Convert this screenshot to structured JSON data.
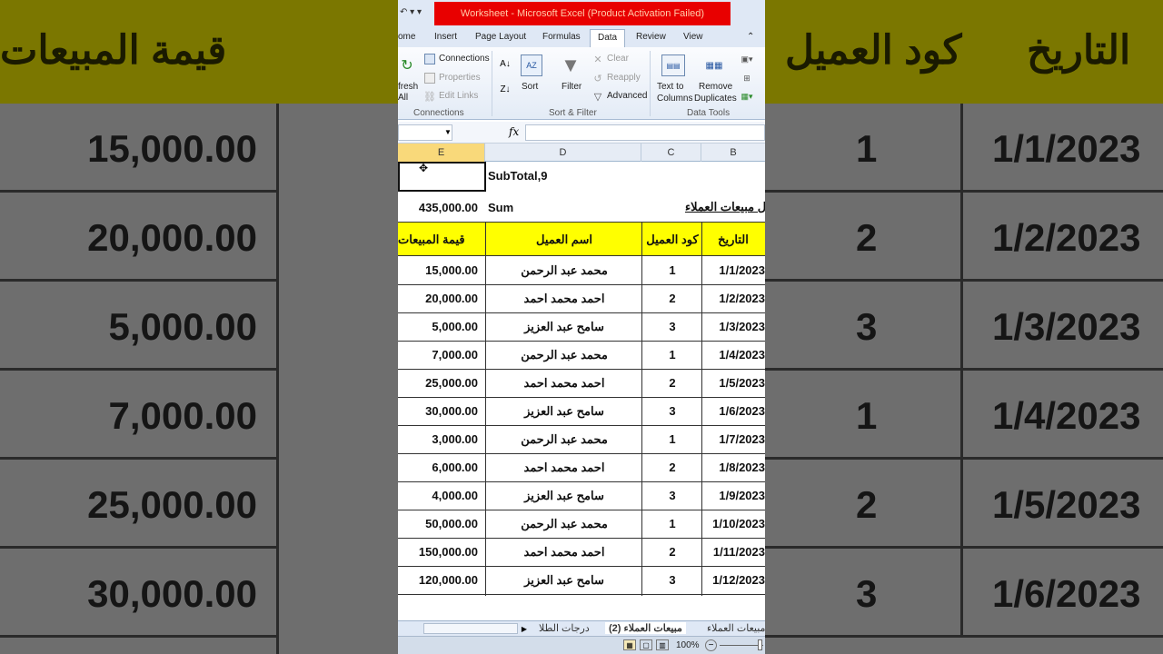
{
  "background": {
    "headers": [
      "قيمة المبيعات",
      "كود العميل",
      "التاريخ"
    ],
    "left_values": [
      "15,000.00",
      "20,000.00",
      "5,000.00",
      "7,000.00",
      "25,000.00",
      "30,000.00"
    ],
    "right_codes": [
      "1",
      "2",
      "3",
      "1",
      "2",
      "3"
    ],
    "right_dates": [
      "1/1/2023",
      "1/2/2023",
      "1/3/2023",
      "1/4/2023",
      "1/5/2023",
      "1/6/2023"
    ]
  },
  "window": {
    "title": "Worksheet - Microsoft Excel (Product Activation Failed)"
  },
  "ribbon": {
    "tabs": [
      "ome",
      "Insert",
      "Page Layout",
      "Formulas",
      "Data",
      "Review",
      "View"
    ],
    "active_tab": "Data",
    "connections": {
      "refresh": "fresh",
      "refresh2": "All",
      "connections": "Connections",
      "properties": "Properties",
      "edit_links": "Edit Links",
      "label": "Connections"
    },
    "sort_filter": {
      "sort": "Sort",
      "filter": "Filter",
      "clear": "Clear",
      "reapply": "Reapply",
      "advanced": "Advanced",
      "label": "Sort & Filter"
    },
    "data_tools": {
      "text_to": "Text to",
      "columns": "Columns",
      "remove": "Remove",
      "duplicates": "Duplicates",
      "label": "Data Tools"
    }
  },
  "formula_bar": {
    "fx": "fx",
    "content": ""
  },
  "columns": [
    "E",
    "D",
    "C",
    "B"
  ],
  "sheet": {
    "subtotal_label": "SubTotal,9",
    "sum_value": "435,000.00",
    "sum_label": "Sum",
    "title_partial": "ل مبيعات العملاء",
    "headers": {
      "value": "قيمة المبيعات",
      "name": "اسم العميل",
      "code": "كود العميل",
      "date": "التاريخ"
    },
    "rows": [
      {
        "value": "15,000.00",
        "name": "محمد عبد الرحمن",
        "code": "1",
        "date": "1/1/2023"
      },
      {
        "value": "20,000.00",
        "name": "احمد محمد احمد",
        "code": "2",
        "date": "1/2/2023"
      },
      {
        "value": "5,000.00",
        "name": "سامح عبد العزيز",
        "code": "3",
        "date": "1/3/2023"
      },
      {
        "value": "7,000.00",
        "name": "محمد عبد الرحمن",
        "code": "1",
        "date": "1/4/2023"
      },
      {
        "value": "25,000.00",
        "name": "احمد محمد احمد",
        "code": "2",
        "date": "1/5/2023"
      },
      {
        "value": "30,000.00",
        "name": "سامح عبد العزيز",
        "code": "3",
        "date": "1/6/2023"
      },
      {
        "value": "3,000.00",
        "name": "محمد عبد الرحمن",
        "code": "1",
        "date": "1/7/2023"
      },
      {
        "value": "6,000.00",
        "name": "احمد محمد احمد",
        "code": "2",
        "date": "1/8/2023"
      },
      {
        "value": "4,000.00",
        "name": "سامح عبد العزيز",
        "code": "3",
        "date": "1/9/2023"
      },
      {
        "value": "50,000.00",
        "name": "محمد عبد الرحمن",
        "code": "1",
        "date": "1/10/2023"
      },
      {
        "value": "150,000.00",
        "name": "احمد محمد احمد",
        "code": "2",
        "date": "1/11/2023"
      },
      {
        "value": "120,000.00",
        "name": "سامح عبد العزيز",
        "code": "3",
        "date": "1/12/2023"
      }
    ]
  },
  "sheet_tabs": [
    "درجات الطلا",
    "مبيعات العملاء (2)",
    "مبيعات العملاء"
  ],
  "status": {
    "zoom": "100%"
  }
}
